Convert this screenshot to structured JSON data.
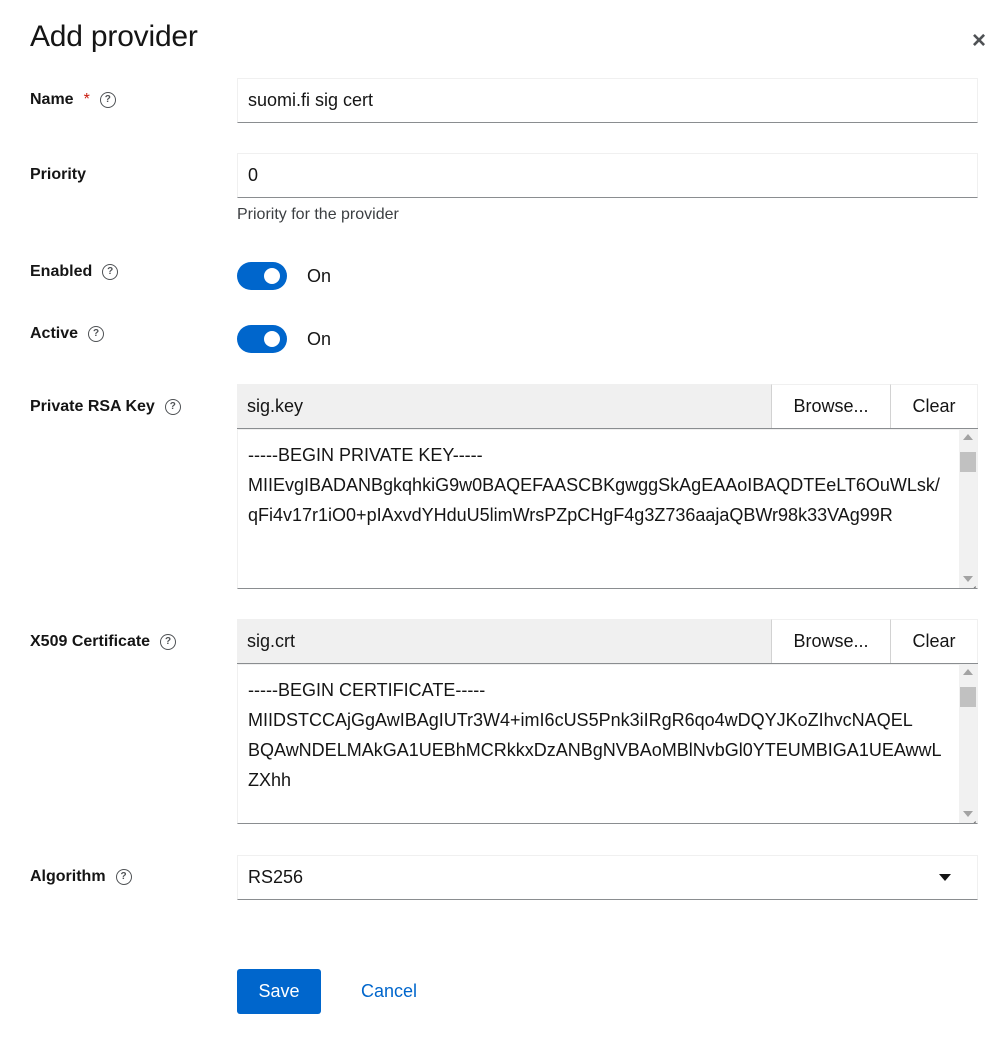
{
  "dialog": {
    "title": "Add provider"
  },
  "fields": {
    "name": {
      "label": "Name",
      "required_mark": "*",
      "value": "suomi.fi sig cert"
    },
    "priority": {
      "label": "Priority",
      "value": "0",
      "helper": "Priority for the provider"
    },
    "enabled": {
      "label": "Enabled",
      "state": "On",
      "checked": true
    },
    "active": {
      "label": "Active",
      "state": "On",
      "checked": true
    },
    "private_key": {
      "label": "Private RSA Key",
      "filename": "sig.key",
      "browse_label": "Browse...",
      "clear_label": "Clear",
      "content": "-----BEGIN PRIVATE KEY-----\nMIIEvgIBADANBgkqhkiG9w0BAQEFAASCBKgwggSkAgEAAoIBAQDTEeLT6OuWLsk/\nqFi4v17r1iO0+pIAxvdYHduU5limWrsPZpCHgF4g3Z736aajaQBWr98k33VAg99R"
    },
    "certificate": {
      "label": "X509 Certificate",
      "filename": "sig.crt",
      "browse_label": "Browse...",
      "clear_label": "Clear",
      "content": "-----BEGIN CERTIFICATE-----\nMIIDSTCCAjGgAwIBAgIUTr3W4+imI6cUS5Pnk3iIRgR6qo4wDQYJKoZIhvcNAQEL\nBQAwNDELMAkGA1UEBhMCRkkxDzANBgNVBAoMBlNvbGl0YTEUMBIGA1UEAwwLZXhh"
    },
    "algorithm": {
      "label": "Algorithm",
      "value": "RS256"
    }
  },
  "actions": {
    "save_label": "Save",
    "cancel_label": "Cancel"
  },
  "icons": {
    "help": "?",
    "close": "×"
  },
  "colors": {
    "primary": "#0066cc",
    "required": "#c9190b"
  }
}
